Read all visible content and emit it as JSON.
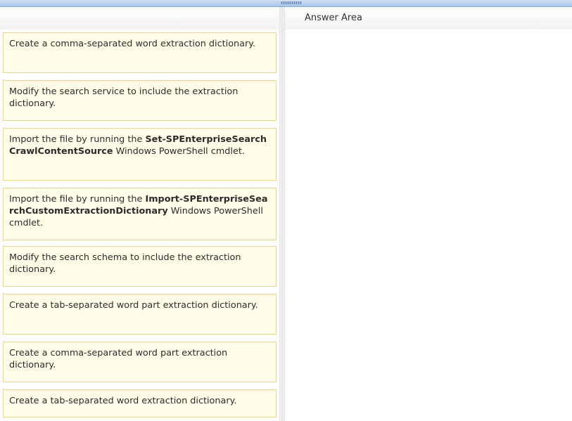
{
  "answer_area": {
    "title": "Answer Area"
  },
  "items": [
    {
      "pre": "Create a comma-separated word extraction dictionary.",
      "bold": "",
      "post": ""
    },
    {
      "pre": "Modify the search service to include the extraction dictionary.",
      "bold": "",
      "post": ""
    },
    {
      "pre": "Import the file by running the ",
      "bold": "Set-SPEnterpriseSearchCrawlContentSource",
      "post": " Windows PowerShell cmdlet."
    },
    {
      "pre": "Import the file by running the ",
      "bold": "Import-SPEnterpriseSearchCustomExtractionDictionary",
      "post": " Windows PowerShell cmdlet."
    },
    {
      "pre": "Modify the search schema to include the extraction dictionary.",
      "bold": "",
      "post": ""
    },
    {
      "pre": "Create a tab-separated word part extraction dictionary.",
      "bold": "",
      "post": ""
    },
    {
      "pre": "Create a comma-separated word part extraction dictionary.",
      "bold": "",
      "post": ""
    },
    {
      "pre": "Create a tab-separated word extraction dictionary.",
      "bold": "",
      "post": ""
    }
  ]
}
